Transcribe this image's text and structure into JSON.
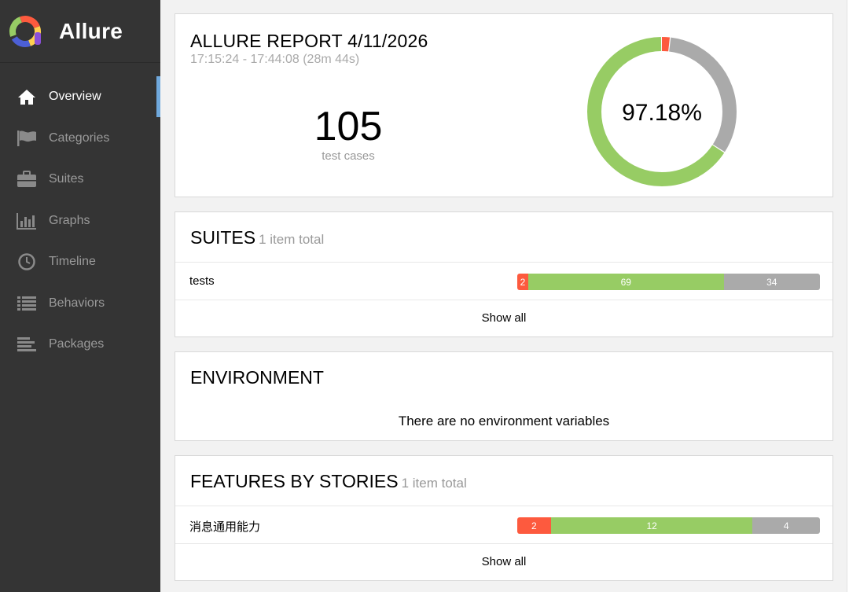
{
  "brand": {
    "name": "Allure"
  },
  "sidebar": {
    "items": [
      {
        "label": "Overview",
        "icon": "home-icon",
        "active": true
      },
      {
        "label": "Categories",
        "icon": "flag-icon",
        "active": false
      },
      {
        "label": "Suites",
        "icon": "briefcase-icon",
        "active": false
      },
      {
        "label": "Graphs",
        "icon": "bar-chart-icon",
        "active": false
      },
      {
        "label": "Timeline",
        "icon": "clock-icon",
        "active": false
      },
      {
        "label": "Behaviors",
        "icon": "list-icon",
        "active": false
      },
      {
        "label": "Packages",
        "icon": "align-left-icon",
        "active": false
      }
    ]
  },
  "summary": {
    "title": "ALLURE REPORT 4/11/2026",
    "time_range": "17:15:24 - 17:44:08 (28m 44s)",
    "count": "105",
    "count_label": "test cases",
    "success_rate": "97.18%",
    "donut": {
      "failed": 2,
      "passed": 69,
      "skipped": 34
    }
  },
  "suites": {
    "title": "SUITES",
    "count": "1 item total",
    "rows": [
      {
        "name": "tests",
        "failed": "2",
        "passed": "69",
        "skipped": "34"
      }
    ],
    "show_all": "Show all"
  },
  "environment": {
    "title": "ENVIRONMENT",
    "message": "There are no environment variables"
  },
  "features": {
    "title": "FEATURES BY STORIES",
    "count": "1 item total",
    "rows": [
      {
        "name": "消息通用能力",
        "failed": "2",
        "passed": "12",
        "skipped": "4"
      }
    ],
    "show_all": "Show all"
  },
  "colors": {
    "failed": "#fd5a3e",
    "passed": "#97cc64",
    "skipped": "#aaaaaa",
    "sidebar_bg": "#343434",
    "active_indicator": "#6fa8dc"
  }
}
